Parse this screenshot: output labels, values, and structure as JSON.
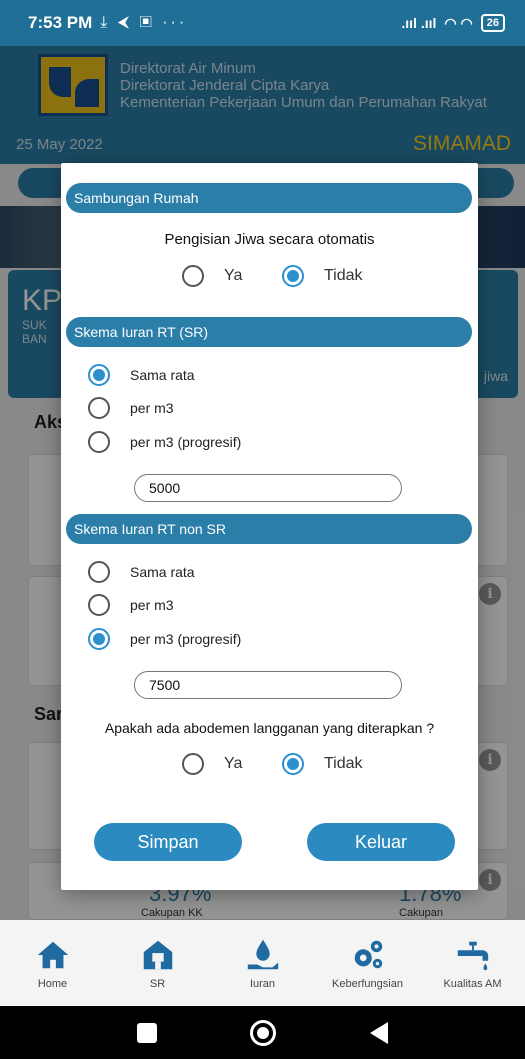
{
  "status_bar": {
    "time": "7:53 PM",
    "left_icons": "⤓ ⮜ ▣ ···",
    "battery": "26"
  },
  "header": {
    "line1": "Direktorat Air Minum",
    "line2": "Direktorat Jenderal Cipta Karya",
    "line3": "Kementerian Pekerjaan Umum dan Perumahan Rakyat"
  },
  "datebar": {
    "date": "25 May 2022",
    "app_name": "SIMAMAD"
  },
  "background": {
    "kp_label": "KP",
    "kp_line1": "SUK",
    "kp_line2": "BAN",
    "jiwa_label": "jiwa",
    "section1_title": "Aks",
    "section2_title": "Sar",
    "pct1": "3.97%",
    "pct2": "1.78%",
    "pct1_caption": "Cakupan KK",
    "pct2_caption": "Cakupan"
  },
  "dialog": {
    "section_sambungan": "Sambungan Rumah",
    "question_jiwa": "Pengisian Jiwa secara otomatis",
    "jiwa_options": [
      "Ya",
      "Tidak"
    ],
    "jiwa_selected": "Tidak",
    "section_sr": "Skema Iuran RT (SR)",
    "sr_options": [
      "Sama rata",
      "per m3",
      "per m3 (progresif)"
    ],
    "sr_selected": "Sama rata",
    "sr_value": "5000",
    "section_nonsr": "Skema Iuran RT non SR",
    "nonsr_options": [
      "Sama rata",
      "per m3",
      "per m3 (progresif)"
    ],
    "nonsr_selected": "per m3 (progresif)",
    "nonsr_value": "7500",
    "question_abodemen": "Apakah ada abodemen langganan yang diterapkan ?",
    "abodemen_options": [
      "Ya",
      "Tidak"
    ],
    "abodemen_selected": "Tidak",
    "save_label": "Simpan",
    "exit_label": "Keluar"
  },
  "bottom_nav": [
    {
      "label": "Home",
      "icon": "home-icon"
    },
    {
      "label": "SR",
      "icon": "house-icon"
    },
    {
      "label": "Iuran",
      "icon": "hand-drop-icon"
    },
    {
      "label": "Keberfungsian",
      "icon": "gears-icon"
    },
    {
      "label": "Kualitas AM",
      "icon": "faucet-icon"
    }
  ],
  "colors": {
    "primary": "#2b7ea8",
    "accent_yellow": "#ffd21c",
    "radio_checked": "#2b8fd0"
  }
}
